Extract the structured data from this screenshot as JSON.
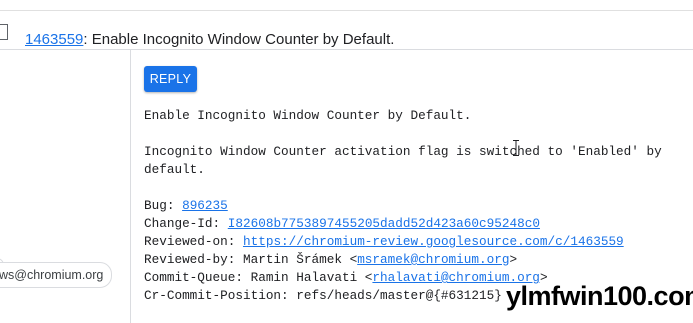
{
  "header": {
    "issue_number": "1463559",
    "title_rest": ": Enable Incognito Window Counter by Default."
  },
  "sidebar": {
    "email_chip": "ws@chromium.org"
  },
  "actions": {
    "reply_label": "REPLY"
  },
  "message": {
    "subject": "Enable Incognito Window Counter by Default.",
    "body": "Incognito Window Counter activation flag is switched to 'Enabled' by default.",
    "footer": [
      {
        "key": "Bug: ",
        "value": "896235",
        "link": true,
        "suffix": ""
      },
      {
        "key": "Change-Id: ",
        "value": "I82608b7753897455205dadd52d423a60c95248c0",
        "link": true,
        "suffix": ""
      },
      {
        "key": "Reviewed-on: ",
        "value": "https://chromium-review.googlesource.com/c/1463559",
        "link": true,
        "suffix": ""
      },
      {
        "key": "Reviewed-by: Martin Šrámek <",
        "value": "msramek@chromium.org",
        "link": true,
        "suffix": ">"
      },
      {
        "key": "Commit-Queue: Ramin Halavati <",
        "value": "rhalavati@chromium.org",
        "link": true,
        "suffix": ">"
      },
      {
        "key": "Cr-Commit-Position: refs/heads/master@{#631215}",
        "value": "",
        "link": false,
        "suffix": ""
      }
    ]
  },
  "watermark": {
    "text": "ylmfwin100.com"
  }
}
